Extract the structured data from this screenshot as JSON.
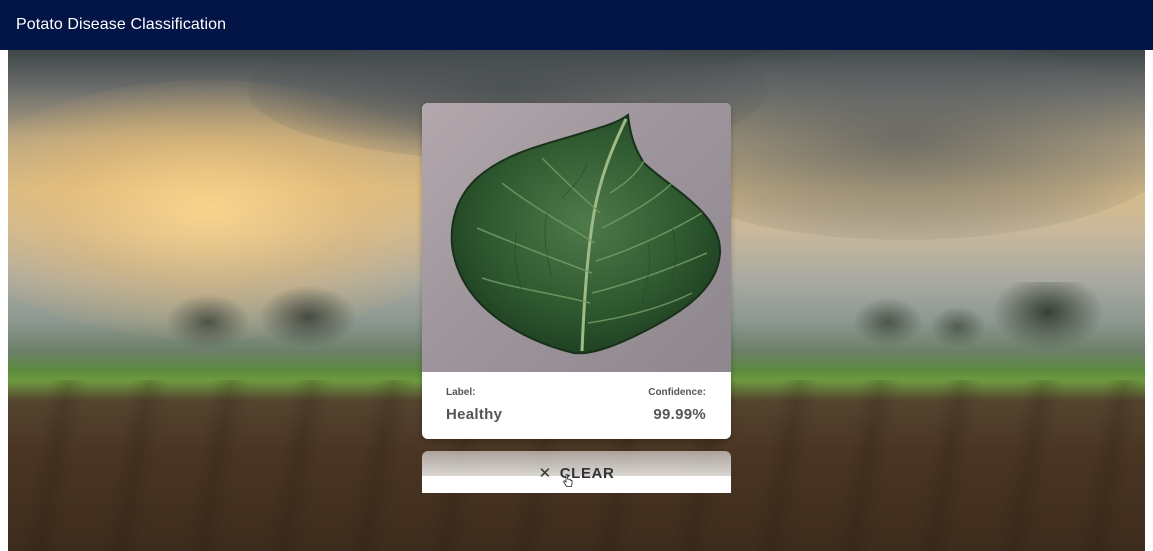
{
  "app": {
    "title": "Potato Disease Classification"
  },
  "result": {
    "label_key": "Label:",
    "label_value": "Healthy",
    "confidence_key": "Confidence:",
    "confidence_value": "99.99%"
  },
  "actions": {
    "clear_label": "CLEAR",
    "clear_icon": "close-icon"
  },
  "colors": {
    "appbar": "#031546",
    "card_text": "#555555"
  }
}
